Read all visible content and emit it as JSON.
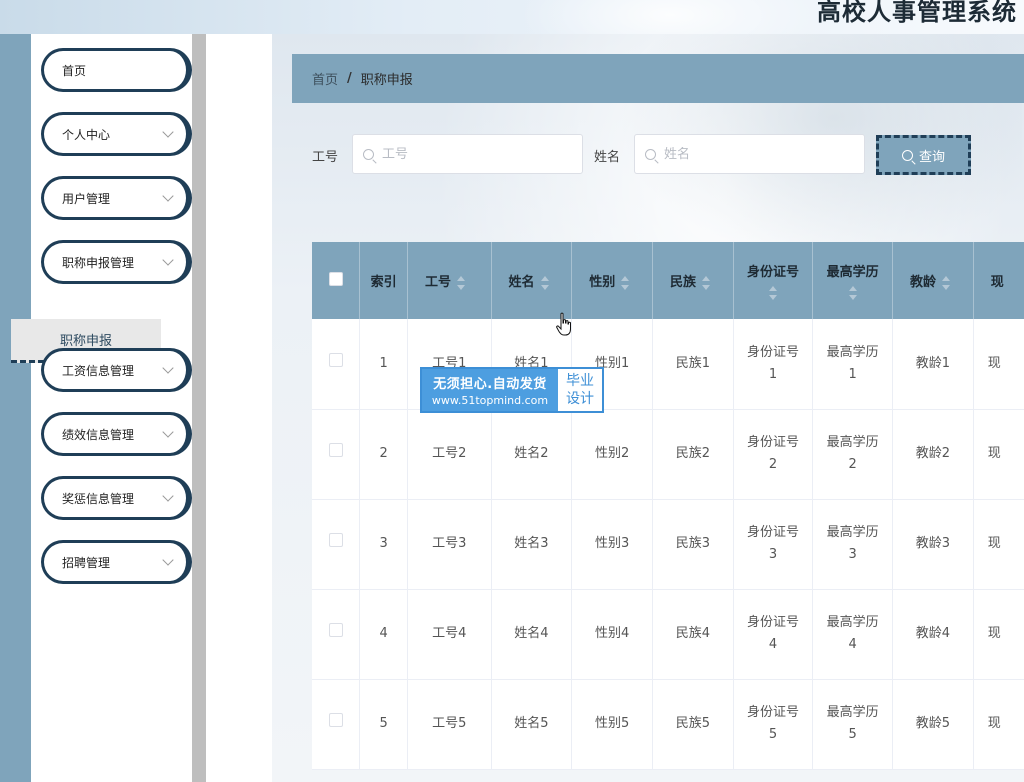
{
  "header": {
    "title": "高校人事管理系统"
  },
  "sidebar": {
    "items": [
      {
        "label": "首页",
        "has_arrow": false
      },
      {
        "label": "个人中心",
        "has_arrow": true
      },
      {
        "label": "用户管理",
        "has_arrow": true
      },
      {
        "label": "职称申报管理",
        "has_arrow": true
      },
      {
        "label": "工资信息管理",
        "has_arrow": true
      },
      {
        "label": "绩效信息管理",
        "has_arrow": true
      },
      {
        "label": "奖惩信息管理",
        "has_arrow": true
      },
      {
        "label": "招聘管理",
        "has_arrow": true
      }
    ],
    "submenu": {
      "label": "职称申报"
    }
  },
  "breadcrumb": {
    "home": "首页",
    "separator": "/",
    "current": "职称申报"
  },
  "search": {
    "field1": {
      "label": "工号",
      "placeholder": "工号",
      "value": ""
    },
    "field2": {
      "label": "姓名",
      "placeholder": "姓名",
      "value": ""
    },
    "button": "查询"
  },
  "table": {
    "headers": [
      "索引",
      "工号",
      "姓名",
      "性别",
      "民族",
      "身份证号",
      "最高学历",
      "教龄",
      "现"
    ],
    "rows": [
      {
        "index": "1",
        "gonghao": "工号1",
        "xingming": "姓名1",
        "xingbie": "性别1",
        "minzu": "民族1",
        "shenfenzheng": "身份证号",
        "shenfenzheng_n": "1",
        "xueli": "最高学历",
        "xueli_n": "1",
        "jiaoling": "教龄1",
        "xian": "现"
      },
      {
        "index": "2",
        "gonghao": "工号2",
        "xingming": "姓名2",
        "xingbie": "性别2",
        "minzu": "民族2",
        "shenfenzheng": "身份证号",
        "shenfenzheng_n": "2",
        "xueli": "最高学历",
        "xueli_n": "2",
        "jiaoling": "教龄2",
        "xian": "现"
      },
      {
        "index": "3",
        "gonghao": "工号3",
        "xingming": "姓名3",
        "xingbie": "性别3",
        "minzu": "民族3",
        "shenfenzheng": "身份证号",
        "shenfenzheng_n": "3",
        "xueli": "最高学历",
        "xueli_n": "3",
        "jiaoling": "教龄3",
        "xian": "现"
      },
      {
        "index": "4",
        "gonghao": "工号4",
        "xingming": "姓名4",
        "xingbie": "性别4",
        "minzu": "民族4",
        "shenfenzheng": "身份证号",
        "shenfenzheng_n": "4",
        "xueli": "最高学历",
        "xueli_n": "4",
        "jiaoling": "教龄4",
        "xian": "现"
      },
      {
        "index": "5",
        "gonghao": "工号5",
        "xingming": "姓名5",
        "xingbie": "性别5",
        "minzu": "民族5",
        "shenfenzheng": "身份证号",
        "shenfenzheng_n": "5",
        "xueli": "最高学历",
        "xueli_n": "5",
        "jiaoling": "教龄5",
        "xian": "现"
      }
    ]
  },
  "watermark": {
    "line1": "无须担心.自动发货",
    "line2": "www.51topmind.com",
    "right1": "毕业",
    "right2": "设计"
  },
  "colors": {
    "accent": "#7fa4bb",
    "border_dark": "#1f3e57",
    "watermark_blue": "#4d9ee0"
  }
}
